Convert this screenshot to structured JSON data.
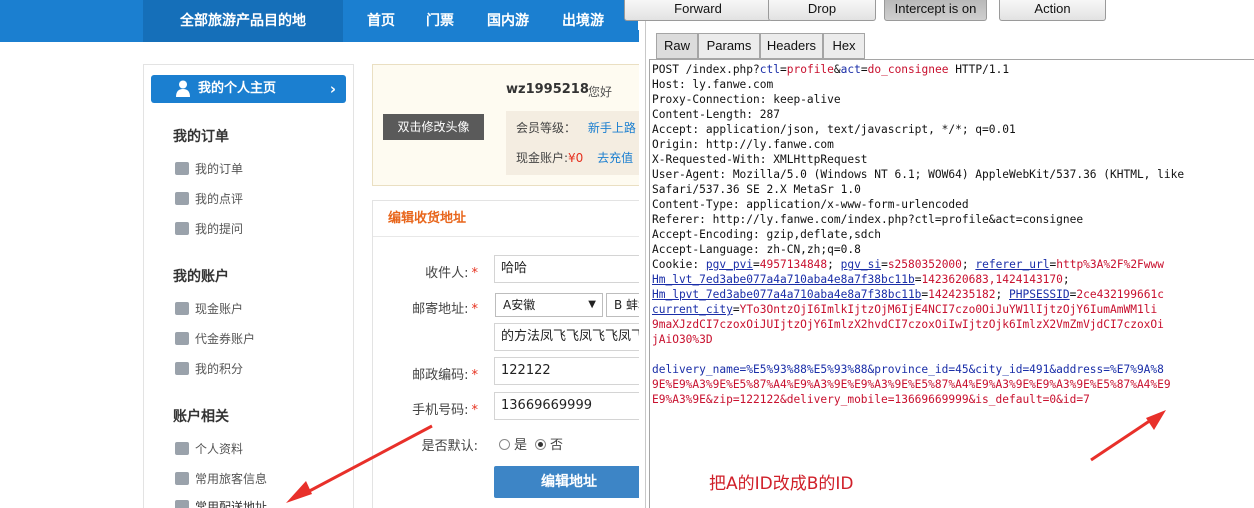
{
  "site": {
    "topnav": {
      "all_destinations": "全部旅游产品目的地",
      "items": [
        "首页",
        "门票",
        "国内游",
        "出境游"
      ]
    },
    "sidebar": {
      "home_button": "我的个人主页",
      "sections": [
        {
          "title": "我的订单",
          "items": [
            "我的订单",
            "我的点评",
            "我的提问"
          ]
        },
        {
          "title": "我的账户",
          "items": [
            "现金账户",
            "代金券账户",
            "我的积分"
          ]
        },
        {
          "title": "账户相关",
          "items": [
            "个人资料",
            "常用旅客信息",
            "常用配送地址"
          ]
        }
      ]
    },
    "profile": {
      "avatar_button": "双击修改头像",
      "username": "wz1995218",
      "greeting": "您好",
      "member_level_label": "会员等级：",
      "member_level_value": "新手上路",
      "cash_label": "现金账户:",
      "cash_value": "¥0",
      "recharge": "去充值"
    },
    "form": {
      "title": "编辑收货地址",
      "recipient_label": "收件人:",
      "recipient_value": "哈哈",
      "address_label": "邮寄地址:",
      "province_value": "A安徽",
      "city_value": "B 蚌埠",
      "street_value": "的方法凤飞飞凤飞飞凤飞飞",
      "zip_label": "邮政编码:",
      "zip_value": "122122",
      "phone_label": "手机号码:",
      "phone_value": "13669669999",
      "default_label": "是否默认:",
      "default_yes": "是",
      "default_no": "否",
      "submit": "编辑地址"
    }
  },
  "proxy": {
    "toolbar": [
      "Forward",
      "Drop",
      "Intercept is on",
      "Action"
    ],
    "tabs": [
      "Raw",
      "Params",
      "Headers",
      "Hex"
    ],
    "request": {
      "line1_method": "POST /index.php?",
      "line1_p1": "ctl",
      "line1_v1": "profile",
      "line1_p2": "act",
      "line1_v2": "do_consignee",
      "line1_proto": " HTTP/1.1",
      "headers": [
        "Host: ly.fanwe.com",
        "Proxy-Connection: keep-alive",
        "Content-Length: 287",
        "Accept: application/json, text/javascript, */*; q=0.01",
        "Origin: http://ly.fanwe.com",
        "X-Requested-With: XMLHttpRequest",
        "User-Agent: Mozilla/5.0 (Windows NT 6.1; WOW64) AppleWebKit/537.36 (KHTML, like",
        "Safari/537.36 SE 2.X MetaSr 1.0",
        "Content-Type: application/x-www-form-urlencoded",
        "Referer: http://ly.fanwe.com/index.php?ctl=profile&act=consignee",
        "Accept-Encoding: gzip,deflate,sdch",
        "Accept-Language: zh-CN,zh;q=0.8"
      ],
      "cookie_label": "Cookie: ",
      "cookie_lines": [
        [
          "pgv_pvi",
          "4957134848",
          "pgv_si",
          "s2580352000",
          "referer_url",
          "http%3A%2F%2Fwww"
        ],
        [
          "Hm_lvt_7ed3abe077a4a710aba4e8a7f38bc11b",
          "1423620683,1424143170"
        ],
        [
          "Hm_lpvt_7ed3abe077a4a710aba4e8a7f38bc11b",
          "1424235182",
          "PHPSESSID",
          "2ce432199661c"
        ],
        [
          "current_city",
          "YTo3OntzOjI6ImlkIjtzOjM6IjE4NCI7czo0OiJuYW1lIjtzOjY6IumAmWM1li"
        ]
      ],
      "cookie_cont": [
        "9maXJzdCI7czoxOiJUIjtzOjY6ImlzX2hvdCI7czoxOiIwIjtzOjk6ImlzX2VmZmVjdCI7czoxOi",
        "jAiO30%3D"
      ],
      "body_line1": "delivery_name=%E5%93%88%E5%93%88&province_id=45&city_id=491&address=%E7%9A%8",
      "body_line2": "9E%E9%A3%9E%E5%87%A4%E9%A3%9E%E9%A3%9E%E5%87%A4%E9%A3%9E%E9%A3%9E%E5%87%A4%E9",
      "body_line3": "E9%A3%9E&zip=122122&delivery_mobile=13669669999&is_default=0&id=7"
    },
    "annotation": "把A的ID改成B的ID"
  }
}
